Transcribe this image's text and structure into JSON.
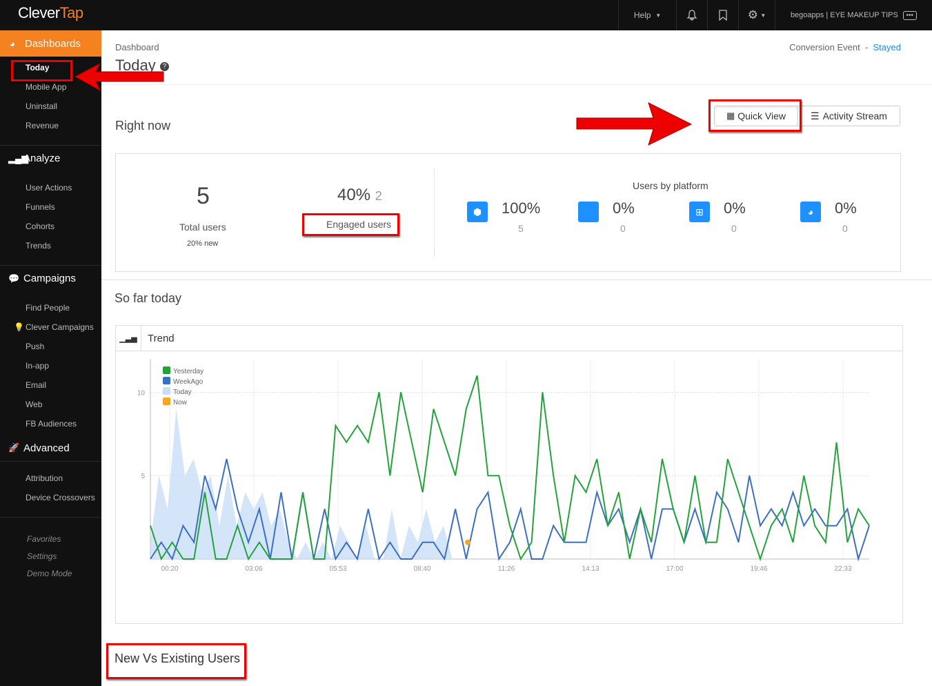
{
  "brand": {
    "part1": "Clever",
    "part2": "Tap"
  },
  "topnav": {
    "help": "Help",
    "account": "begoapps | EYE MAKEUP TIPS",
    "more": "•••"
  },
  "sidebar": {
    "dashboards": "Dashboards",
    "dash_items": [
      "Today",
      "Mobile App",
      "Uninstall",
      "Revenue"
    ],
    "analyze": "Analyze",
    "analyze_items": [
      "User Actions",
      "Funnels",
      "Cohorts",
      "Trends"
    ],
    "campaigns": "Campaigns",
    "campaign_items": [
      "Find People",
      "Clever Campaigns",
      "Push",
      "In-app",
      "Email",
      "Web",
      "FB Audiences"
    ],
    "advanced": "Advanced",
    "advanced_items": [
      "Attribution",
      "Device Crossovers"
    ],
    "footer": [
      "Favorites",
      "Settings",
      "Demo Mode"
    ]
  },
  "header": {
    "breadcrumb": "Dashboard",
    "title": "Today",
    "conversion_label": "Conversion Event",
    "sep": "-",
    "conversion_value": "Stayed"
  },
  "rightnow": {
    "title": "Right now",
    "quick_view": "Quick View",
    "activity_stream": "Activity Stream",
    "total_users": "5",
    "total_label": "Total users",
    "new_label": "20% new",
    "engaged_pct": "40%",
    "engaged_count": "2",
    "engaged_label": "Engaged users",
    "platform_title": "Users by platform",
    "platforms": [
      {
        "icon": "android-icon",
        "pct": "100%",
        "count": "5"
      },
      {
        "icon": "apple-icon",
        "pct": "0%",
        "count": "0"
      },
      {
        "icon": "windows-icon",
        "pct": "0%",
        "count": "0"
      },
      {
        "icon": "globe-icon",
        "pct": "0%",
        "count": "0"
      }
    ]
  },
  "sofar": {
    "title": "So far today",
    "panel_title": "Trend"
  },
  "chart_data": {
    "type": "line",
    "x_ticks": [
      "00:20",
      "03:06",
      "05:53",
      "08:40",
      "11:26",
      "14:13",
      "17:00",
      "19:46",
      "22:33"
    ],
    "y_ticks": [
      "10",
      "5"
    ],
    "ylim": [
      0,
      12
    ],
    "grid": true,
    "legend": "top-left",
    "series": [
      {
        "name": "Yesterday",
        "color": "#22a33a",
        "values": [
          2,
          0,
          1,
          0,
          0,
          4,
          0,
          0,
          2,
          0,
          1,
          0,
          0,
          0,
          4,
          0,
          0,
          8,
          7,
          8,
          7,
          10,
          5,
          10,
          7,
          4,
          9,
          7,
          5,
          9,
          11,
          5,
          5,
          2,
          0,
          1,
          10,
          5,
          1,
          5,
          4,
          6,
          2,
          4,
          0,
          3,
          1,
          6,
          3,
          1,
          5,
          1,
          1,
          6,
          4,
          2,
          0,
          2,
          3,
          1,
          5,
          2,
          1,
          7,
          1,
          3,
          2
        ]
      },
      {
        "name": "WeekAgo",
        "color": "#3a6fc1",
        "values": [
          0,
          1,
          0,
          2,
          1,
          5,
          3,
          6,
          3,
          1,
          3,
          0,
          4,
          0,
          4,
          0,
          3,
          0,
          1,
          0,
          3,
          0,
          1,
          0,
          0,
          1,
          1,
          0,
          3,
          0,
          3,
          4,
          0,
          1,
          3,
          0,
          0,
          2,
          1,
          1,
          1,
          4,
          2,
          3,
          1,
          3,
          0,
          3,
          3,
          1,
          3,
          1,
          4,
          3,
          1,
          5,
          2,
          3,
          2,
          4,
          2,
          3,
          2,
          2,
          3,
          0,
          2
        ]
      },
      {
        "name": "Today",
        "color": "#c9dff7",
        "values": [
          1,
          5,
          3,
          9,
          5,
          6,
          4,
          5,
          2,
          5,
          2,
          4,
          3,
          4,
          2,
          3,
          1,
          0,
          1,
          0,
          1,
          0,
          2,
          1,
          0,
          2,
          0,
          0,
          3,
          0,
          2,
          1,
          3,
          1,
          2,
          0,
          0
        ]
      },
      {
        "name": "Now",
        "color": "#f5a623",
        "values": [
          1
        ]
      }
    ]
  },
  "newvs": {
    "title": "New Vs Existing Users"
  },
  "colors": {
    "accent": "#f58220",
    "link": "#1e8bd6",
    "highlight": "#ee0000"
  }
}
